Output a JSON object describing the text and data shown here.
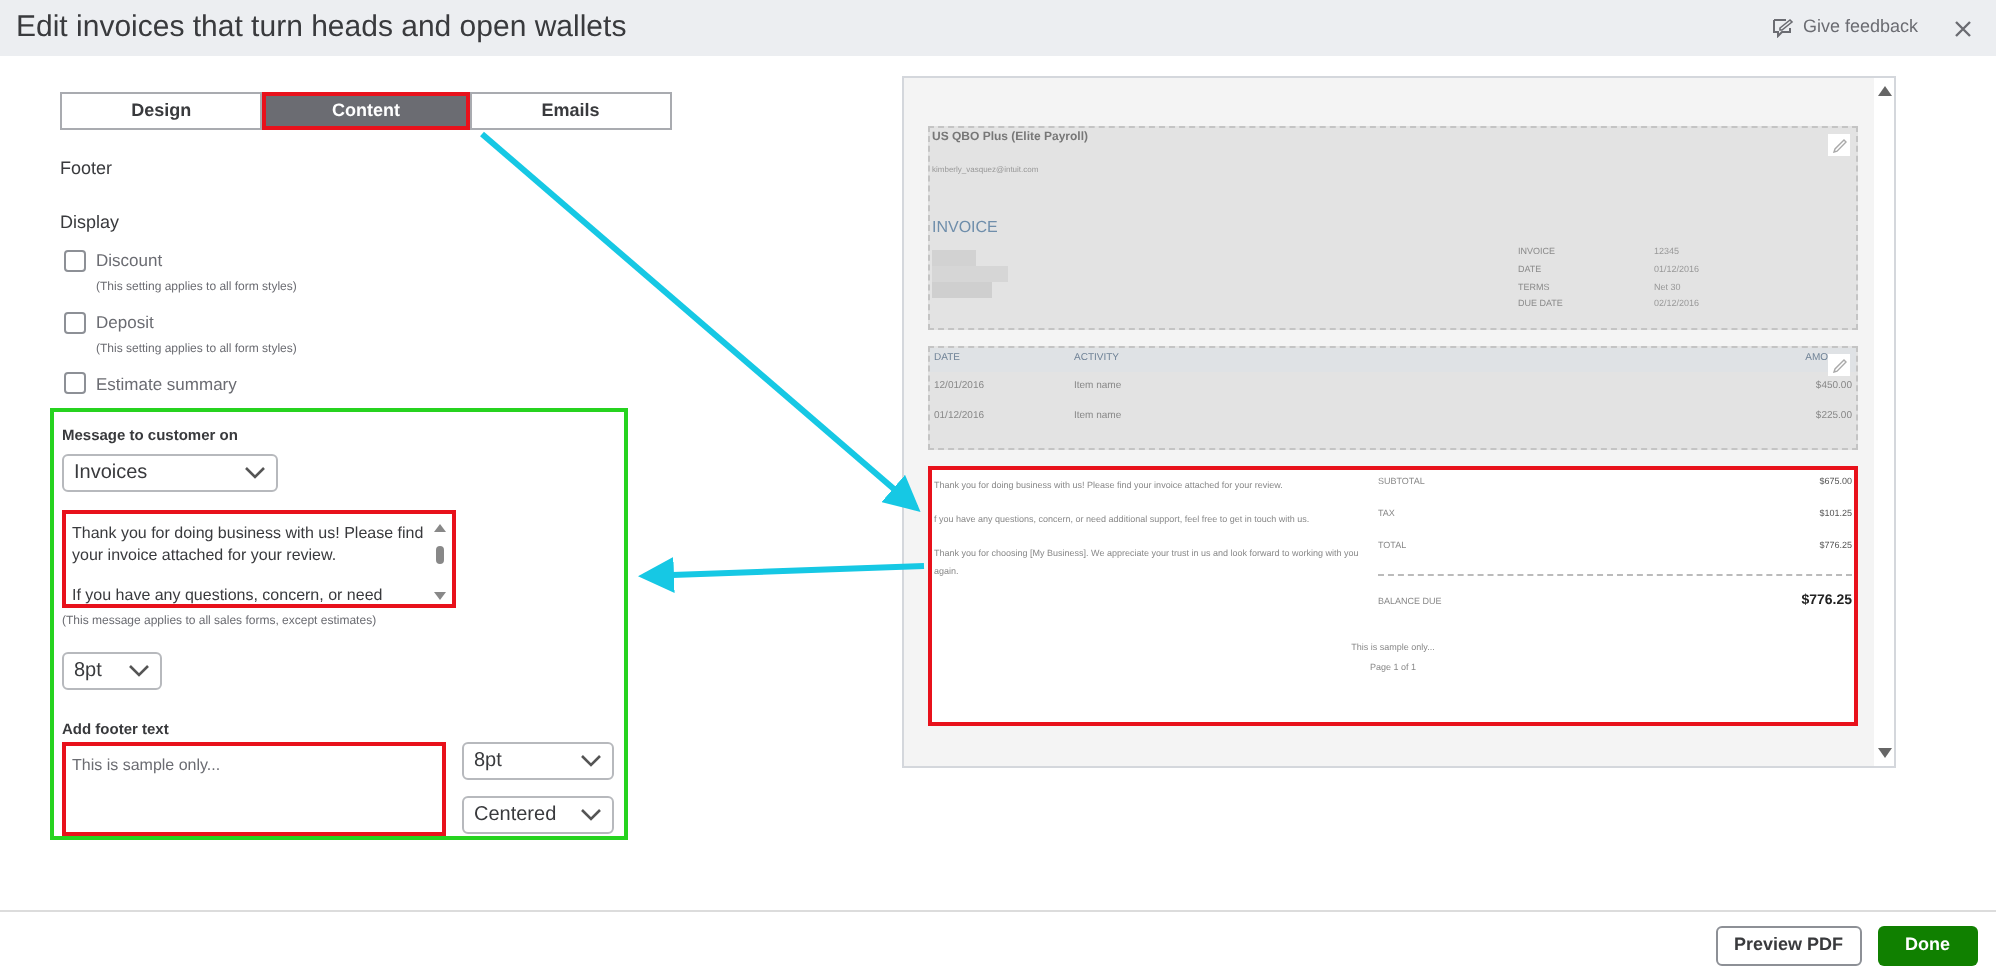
{
  "header": {
    "title": "Edit invoices that turn heads and open wallets",
    "feedback": "Give feedback"
  },
  "tabs": [
    {
      "label": "Design",
      "selected": false
    },
    {
      "label": "Content",
      "selected": true
    },
    {
      "label": "Emails",
      "selected": false
    }
  ],
  "section_label": "Footer",
  "display": {
    "heading": "Display",
    "options": [
      {
        "label": "Discount",
        "checked": false,
        "note": "(This setting applies to all form styles)"
      },
      {
        "label": "Deposit",
        "checked": false,
        "note": "(This setting applies to all form styles)"
      },
      {
        "label": "Estimate summary",
        "checked": false
      }
    ]
  },
  "message": {
    "heading": "Message to customer on",
    "form": "Invoices",
    "paragraphs": [
      "Thank you for doing business with us! Please find your invoice attached for your review.",
      "If you have any questions, concern, or need"
    ],
    "note": "(This message applies to all sales forms, except estimates)",
    "font_size": "8pt"
  },
  "footer_text": {
    "heading": "Add footer text",
    "value": "This is sample only...",
    "font_size": "8pt",
    "alignment": "Centered"
  },
  "preview": {
    "company": "US QBO Plus (Elite Payroll)",
    "email": "kimberly_vasquez@intuit.com",
    "doc_title": "INVOICE",
    "details": [
      {
        "label": "INVOICE",
        "value": "12345"
      },
      {
        "label": "DATE",
        "value": "01/12/2016"
      },
      {
        "label": "TERMS",
        "value": "Net 30"
      },
      {
        "label": "DUE DATE",
        "value": "02/12/2016"
      }
    ],
    "columns": [
      "DATE",
      "ACTIVITY",
      "AMO"
    ],
    "rows": [
      [
        "12/01/2016",
        "Item name",
        "$450.00"
      ],
      [
        "01/12/2016",
        "Item name",
        "$225.00"
      ]
    ],
    "message_paragraphs": [
      "Thank you for doing business with us! Please find your invoice attached for your review.",
      "f you have any questions, concern, or need additional support, feel free to get in touch with us.",
      "Thank you for choosing [My Business]. We appreciate your trust in us and look forward to working with you again."
    ],
    "totals": [
      {
        "label": "SUBTOTAL",
        "value": "$675.00"
      },
      {
        "label": "TAX",
        "value": "$101.25"
      },
      {
        "label": "TOTAL",
        "value": "$776.25"
      }
    ],
    "balance": {
      "label": "BALANCE DUE",
      "value": "$776.25"
    },
    "footer_text": "This is sample only...",
    "page": "Page 1 of 1"
  },
  "buttons": [
    {
      "label": "Preview PDF",
      "kind": "secondary"
    },
    {
      "label": "Done",
      "kind": "primary"
    }
  ]
}
